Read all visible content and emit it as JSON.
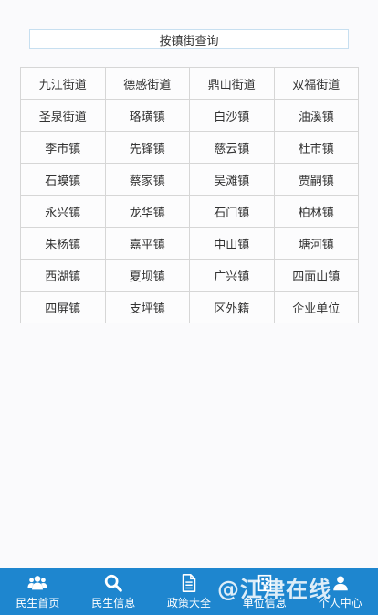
{
  "header": {
    "title": "按镇街查询"
  },
  "towns": [
    "九江街道",
    "德感街道",
    "鼎山街道",
    "双福街道",
    "圣泉街道",
    "珞璜镇",
    "白沙镇",
    "油溪镇",
    "李市镇",
    "先锋镇",
    "慈云镇",
    "杜市镇",
    "石蟆镇",
    "蔡家镇",
    "吴滩镇",
    "贾嗣镇",
    "永兴镇",
    "龙华镇",
    "石门镇",
    "柏林镇",
    "朱杨镇",
    "嘉平镇",
    "中山镇",
    "塘河镇",
    "西湖镇",
    "夏坝镇",
    "广兴镇",
    "四面山镇",
    "四屏镇",
    "支坪镇",
    "区外籍",
    "企业单位"
  ],
  "nav": [
    {
      "label": "民生首页",
      "icon": "people-icon"
    },
    {
      "label": "民生信息",
      "icon": "search-icon"
    },
    {
      "label": "政策大全",
      "icon": "document-icon"
    },
    {
      "label": "单位信息",
      "icon": "building-icon"
    },
    {
      "label": "个人中心",
      "icon": "user-icon"
    }
  ],
  "watermark": "@江津在线"
}
